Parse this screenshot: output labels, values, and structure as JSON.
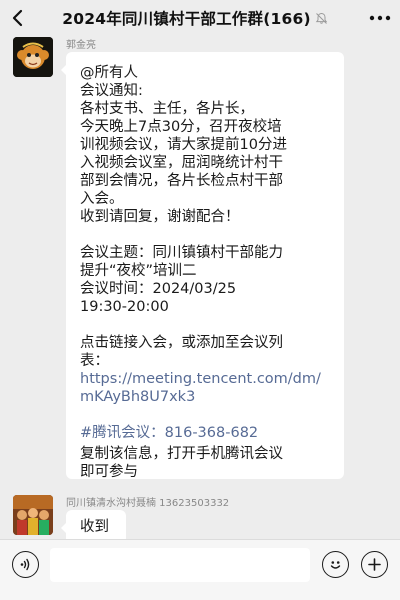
{
  "header": {
    "title": "2024年同川镇村干部工作群(166)",
    "back_icon": "chevron-left-icon",
    "mute_icon": "bell-off-icon",
    "more_icon": "more-dots-icon"
  },
  "messages": [
    {
      "sender": "郭金亮",
      "avatar_icon": "monkey-avatar",
      "lines": [
        "@所有人",
        "会议通知:",
        "      各村支书、主任，各片长，",
        "今天晚上7点30分，召开夜校培",
        "训视频会议，请大家提前10分进",
        "入视频会议室，屈润晓统计村干",
        "部到会情况，各片长检点村干部",
        "入会。",
        "      收到请回复，谢谢配合！",
        "",
        "会议主题：同川镇镇村干部能力",
        "提升“夜校”培训二",
        "会议时间：2024/03/25",
        "               19:30-20:00",
        "",
        "点击链接入会，或添加至会议列",
        "表：",
        "https://meeting.tencent.com/dm/",
        "mKAyBh8U7xk3",
        "",
        "#腾讯会议：816-368-682",
        "",
        "复制该信息，打开手机腾讯会议",
        "即可参与"
      ]
    },
    {
      "sender": "同川镇清水沟村聂楠 13623503332",
      "avatar_icon": "group-photo-avatar",
      "lines": [
        "收到"
      ]
    }
  ],
  "input_bar": {
    "voice_icon": "voice-icon",
    "emoji_icon": "emoji-icon",
    "add_icon": "plus-icon",
    "text_value": ""
  },
  "colors": {
    "background": "#ededed",
    "bubble": "#ffffff",
    "link": "#576b95"
  }
}
